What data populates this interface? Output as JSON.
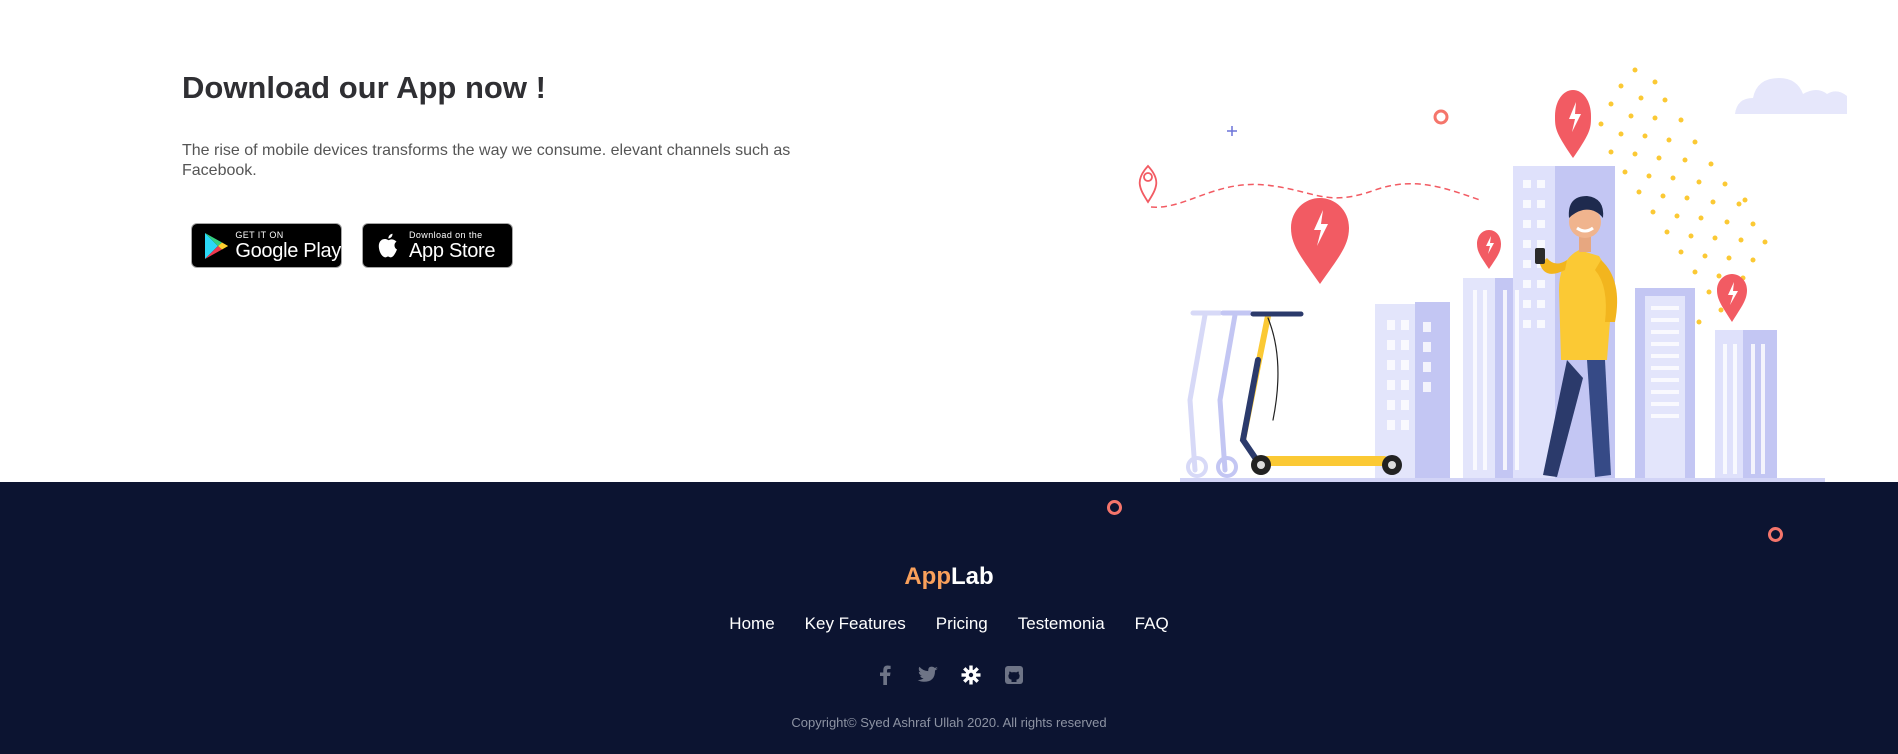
{
  "download": {
    "title": "Download our App now !",
    "text": "The rise of mobile devices transforms the way we consume. elevant channels such as Facebook.",
    "google_play": {
      "small": "GET IT ON",
      "big": "Google Play"
    },
    "app_store": {
      "small": "Download on the",
      "big": "App Store"
    }
  },
  "footer": {
    "brand_part1": "App",
    "brand_part2": "Lab",
    "nav": [
      "Home",
      "Key Features",
      "Pricing",
      "Testemonia",
      "FAQ"
    ],
    "socials": [
      "facebook-icon",
      "twitter-icon",
      "gear-icon",
      "github-icon"
    ],
    "copyright": "Copyright© Syed Ashraf Ullah 2020. All rights reserved"
  },
  "colors": {
    "footer_bg": "#0c1431",
    "brand_accent": "#f9a05b",
    "ring_accent": "#f5756b",
    "pin_red": "#f25b63",
    "scooter_yellow": "#fbc934",
    "building_lavender": "#c3c6f3"
  }
}
